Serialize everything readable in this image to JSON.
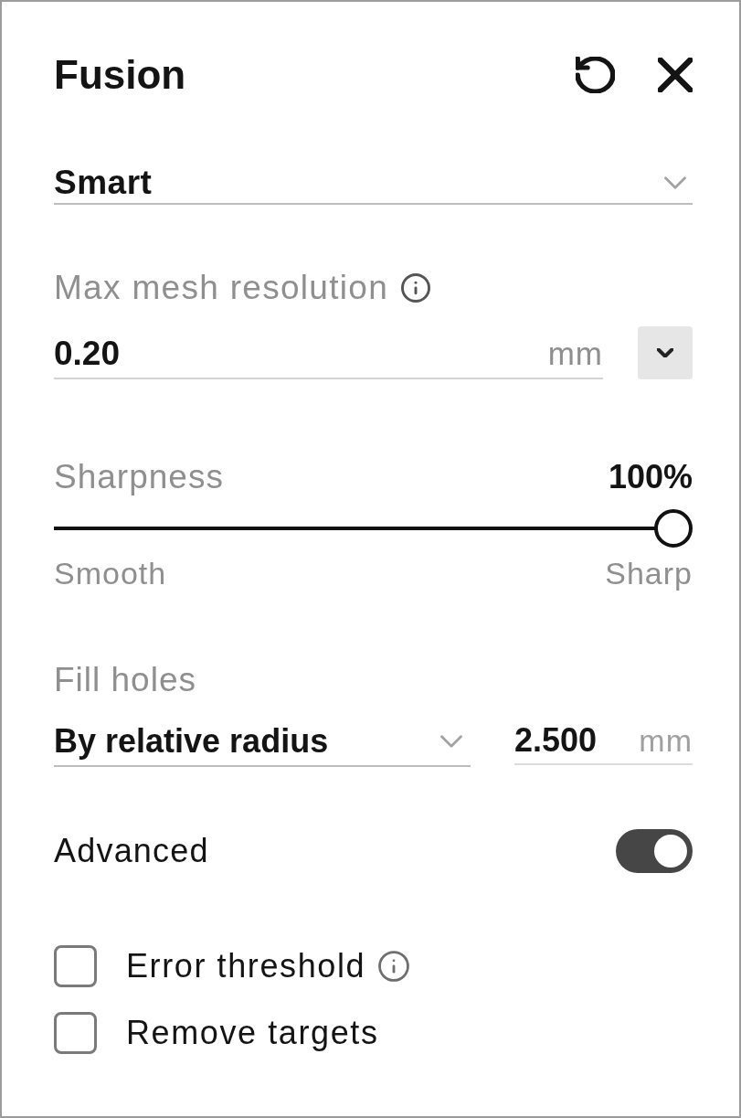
{
  "panel": {
    "title": "Fusion"
  },
  "mode_dropdown": {
    "value": "Smart"
  },
  "max_mesh_resolution": {
    "label": "Max mesh resolution",
    "value": "0.20",
    "unit": "mm"
  },
  "sharpness": {
    "label": "Sharpness",
    "reading": "100%",
    "level": 1,
    "min_label": "Smooth",
    "max_label": "Sharp"
  },
  "fill_holes": {
    "label": "Fill holes",
    "method": "By relative radius",
    "value": "2.500",
    "unit": "mm"
  },
  "advanced": {
    "label": "Advanced",
    "on": true
  },
  "options": [
    {
      "label": "Error threshold",
      "checked": false,
      "info": true
    },
    {
      "label": "Remove targets",
      "checked": false,
      "info": false
    }
  ]
}
